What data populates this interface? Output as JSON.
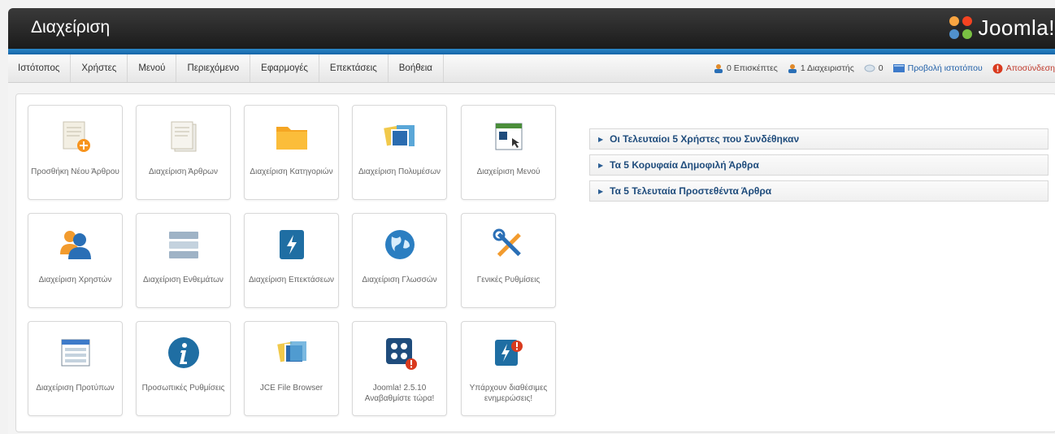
{
  "header": {
    "title": "Διαχείριση",
    "brand": "Joomla!"
  },
  "menu": {
    "items": [
      "Ιστότοπος",
      "Χρήστες",
      "Μενού",
      "Περιεχόμενο",
      "Εφαρμογές",
      "Επεκτάσεις",
      "Βοήθεια"
    ]
  },
  "status": {
    "visitors": "0 Επισκέπτες",
    "admins": "1 Διαχειριστής",
    "messages": "0",
    "view_site": "Προβολή ιστοτόπου",
    "logout": "Αποσύνδεση"
  },
  "tiles": [
    {
      "label": "Προσθήκη Νέου Άρθρου",
      "icon": "add-article-icon"
    },
    {
      "label": "Διαχείριση Άρθρων",
      "icon": "articles-icon"
    },
    {
      "label": "Διαχείριση Κατηγοριών",
      "icon": "folder-icon"
    },
    {
      "label": "Διαχείριση Πολυμέσων",
      "icon": "media-icon"
    },
    {
      "label": "Διαχείριση Μενού",
      "icon": "menu-manager-icon"
    },
    {
      "label": "Διαχείριση Χρηστών",
      "icon": "users-icon"
    },
    {
      "label": "Διαχείριση Ενθεμάτων",
      "icon": "modules-icon"
    },
    {
      "label": "Διαχείριση Επεκτάσεων",
      "icon": "extensions-icon"
    },
    {
      "label": "Διαχείριση Γλωσσών",
      "icon": "globe-icon"
    },
    {
      "label": "Γενικές Ρυθμίσεις",
      "icon": "tools-icon"
    },
    {
      "label": "Διαχείριση Προτύπων",
      "icon": "templates-icon"
    },
    {
      "label": "Προσωπικές Ρυθμίσεις",
      "icon": "info-icon"
    },
    {
      "label": "JCE File Browser",
      "icon": "file-browser-icon"
    },
    {
      "label": "Joomla! 2.5.10 Αναβαθμίστε τώρα!",
      "icon": "joomla-update-icon"
    },
    {
      "label": "Υπάρχουν διαθέσιμες ενημερώσεις!",
      "icon": "extension-update-icon"
    }
  ],
  "modules": [
    "Οι Τελευταίοι 5 Χρήστες που Συνδέθηκαν",
    "Τα 5 Κορυφαία Δημοφιλή Άρθρα",
    "Τα 5 Τελευταία Προστεθέντα Άρθρα"
  ],
  "colors": {
    "header": "#262626",
    "accent_strip": "#1f75b8",
    "module_text": "#1f4c7c"
  }
}
